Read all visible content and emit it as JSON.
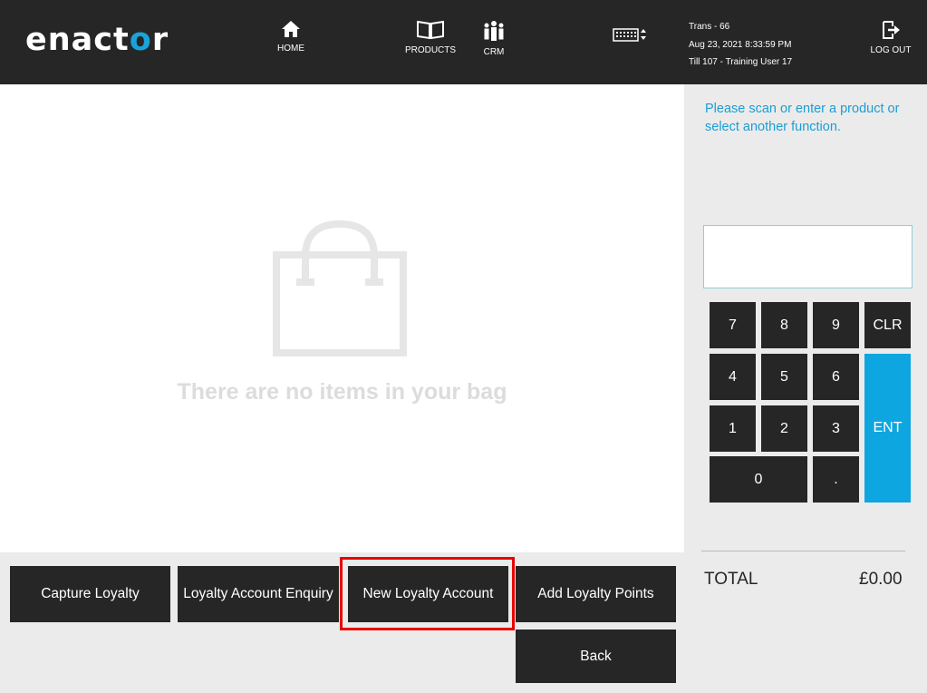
{
  "header": {
    "logo_text": "enactor",
    "nav": {
      "home_label": "HOME",
      "products_label": "PRODUCTS",
      "crm_label": "CRM",
      "logout_label": "LOG OUT"
    },
    "transaction": {
      "trans": "Trans - 66",
      "datetime": "Aug 23, 2021 8:33:59 PM",
      "till": "Till 107 - Training User 17"
    }
  },
  "basket": {
    "empty_message": "There are no items in your bag"
  },
  "prompt": "Please scan or enter a product or select another function.",
  "keypad": {
    "k7": "7",
    "k8": "8",
    "k9": "9",
    "clr": "CLR",
    "k4": "4",
    "k5": "5",
    "k6": "6",
    "k1": "1",
    "k2": "2",
    "k3": "3",
    "ent": "ENT",
    "k0": "0",
    "dot": "."
  },
  "total": {
    "label": "TOTAL",
    "value": "£0.00"
  },
  "functions": {
    "capture_loyalty": "Capture Loyalty",
    "loyalty_enquiry": "Loyalty Account Enquiry",
    "new_loyalty_account": "New Loyalty Account",
    "add_loyalty_points": "Add Loyalty Points",
    "back": "Back"
  },
  "colors": {
    "header_bg": "#262626",
    "accent_blue": "#1a9ed4",
    "ent_key": "#0ea6e0",
    "highlight": "#e60000"
  }
}
